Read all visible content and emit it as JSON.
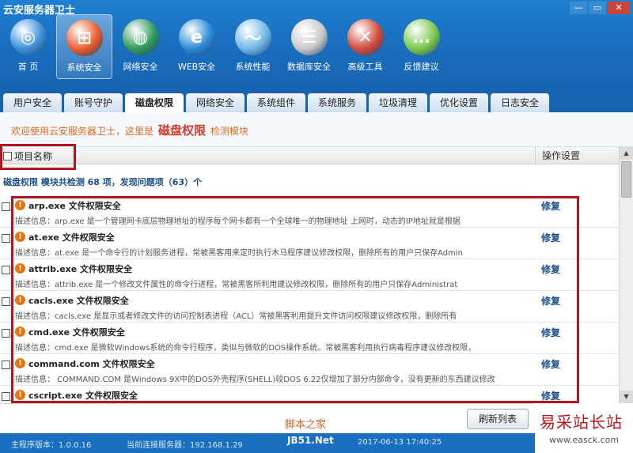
{
  "app": {
    "title": "云安服务器卫士",
    "ctrl_minimize": "—",
    "ctrl_restore": "▭",
    "ctrl_close": "✕"
  },
  "toolbar": [
    {
      "label": "首 页",
      "icon": "home-globe-icon",
      "color": "#3c8fd8",
      "active": false
    },
    {
      "label": "系统安全",
      "icon": "windows-logo-icon",
      "color": "#e85a2a",
      "active": true
    },
    {
      "label": "网络安全",
      "icon": "earth-icon",
      "color": "#2f9a5a",
      "active": false
    },
    {
      "label": "WEB安全",
      "icon": "ie-icon",
      "color": "#2a8ad8",
      "active": false
    },
    {
      "label": "系统性能",
      "icon": "monitor-pulse-icon",
      "color": "#6fb8e8",
      "active": false
    },
    {
      "label": "数据库安全",
      "icon": "database-lock-icon",
      "color": "#c9c9c9",
      "active": false
    },
    {
      "label": "高级工具",
      "icon": "tools-icon",
      "color": "#d24a3a",
      "active": false
    },
    {
      "label": "反馈建议",
      "icon": "chat-bubble-icon",
      "color": "#7bc94a",
      "active": false
    }
  ],
  "tabs": [
    "用户安全",
    "账号守护",
    "磁盘权限",
    "网络安全",
    "系统组件",
    "系统服务",
    "垃圾清理",
    "优化设置",
    "日志安全"
  ],
  "welcome": {
    "prefix": "欢迎使用云安服务器卫士，这里是",
    "module": "磁盘权限",
    "suffix": "检测模块"
  },
  "list": {
    "name_header": "项目名称",
    "op_header": "操作设置",
    "summary": "磁盘权限 模块共检测 68 项，发现问题项（63）个",
    "fix_label": "修复",
    "items": [
      {
        "title": "arp.exe 文件权限安全",
        "desc": "描述信息：arp.exe 是一个管理网卡底层物理地址的程序每个网卡都有一个全球唯一的物理地址 上网时，动态的IP地址就是根据"
      },
      {
        "title": "at.exe 文件权限安全",
        "desc": "描述信息：at.exe 是一个命令行的计划服务进程，常被黑客用来定时执行木马程序建议修改权限，删除所有的用户只保存Admin"
      },
      {
        "title": "attrib.exe 文件权限安全",
        "desc": "描述信息：attrib.exe 是一个修改文件属性的命令行进程，常被黑客所利用建议修改权限，删除所有的用户只保存Administrat"
      },
      {
        "title": "cacls.exe 文件权限安全",
        "desc": "描述信息：cacls.exe  是显示或者修改文件的访问控制表进程（ACL）常被黑客利用提升文件访问权限建议修改权限，删除所有"
      },
      {
        "title": "cmd.exe 文件权限安全",
        "desc": "描述信息：cmd.exe  是微软Windows系统的命令行程序，类似与微软的DOS操作系统。常被黑客利用执行病毒程序建议修改权限，"
      },
      {
        "title": "command.com 文件权限安全",
        "desc": "描述信息：  COMMAND.COM  是Windows 9X中的DOS外壳程序(SHELL)较DOS 6.22仅增加了部分内部命令，没有更新的东西建议修改"
      },
      {
        "title": "cscript.exe 文件权限安全",
        "desc": ""
      }
    ]
  },
  "bottom": {
    "refresh_label": "刷新列表"
  },
  "status": {
    "version": "主程序版本：1.0.0.16",
    "server": "当前连接服务器：192.168.1.29",
    "time": "2017-06-13 17:40:25"
  },
  "watermarks": {
    "site1": "脚本之家",
    "site2": "JB51.Net",
    "site3": "易采站长站",
    "site4": "www.easck.com"
  }
}
